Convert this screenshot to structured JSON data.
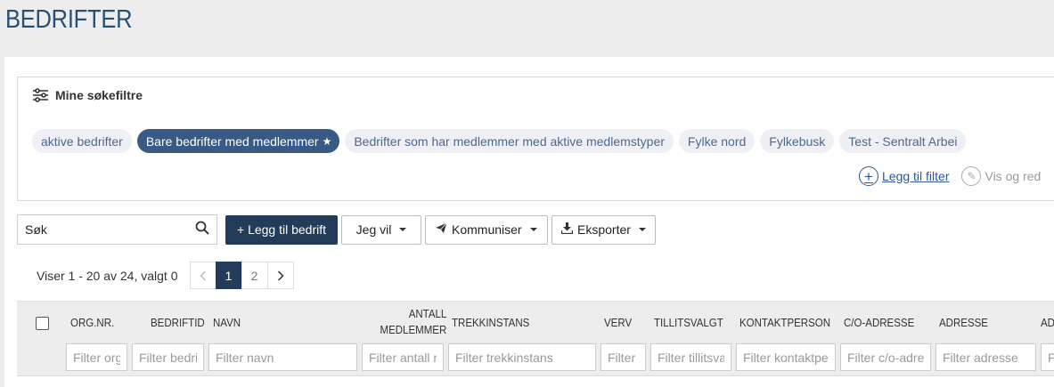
{
  "page": {
    "title": "BEDRIFTER"
  },
  "saved_filters": {
    "title": "Mine søkefiltre",
    "chips": [
      {
        "label": "aktive bedrifter",
        "active": false
      },
      {
        "label": "Bare bedrifter med medlemmer",
        "active": true,
        "icon": "star-icon"
      },
      {
        "label": "Bedrifter som har medlemmer med aktive medlemstyper",
        "active": false
      },
      {
        "label": "Fylke nord",
        "active": false
      },
      {
        "label": "Fylkebusk",
        "active": false
      },
      {
        "label": "Test - Sentralt Arbei",
        "active": false
      }
    ],
    "add_label": "Legg til filter",
    "edit_label": "Vis og red"
  },
  "toolbar": {
    "search_placeholder": "Søk",
    "add_company_label": "+ Legg til bedrift",
    "i_want_label": "Jeg vil",
    "communicate_label": "Kommuniser",
    "export_label": "Eksporter"
  },
  "pagination": {
    "info": "Viser 1 - 20 av 24, valgt 0",
    "pages": [
      "1",
      "2"
    ],
    "current": "1"
  },
  "table": {
    "columns": [
      {
        "label": "ORG.NR.",
        "filter": "Filter org"
      },
      {
        "label": "BEDRIFTID",
        "filter": "Filter bedri"
      },
      {
        "label": "NAVN",
        "filter": "Filter navn"
      },
      {
        "label": "ANTALL",
        "label2": "MEDLEMMER",
        "filter": "Filter antall m"
      },
      {
        "label": "TREKKINSTANS",
        "filter": "Filter trekkinstans"
      },
      {
        "label": "VERV",
        "filter": "Filter"
      },
      {
        "label": "TILLITSVALGT",
        "filter": "Filter tillitsvalgt"
      },
      {
        "label": "KONTAKTPERSON",
        "filter": "Filter kontaktpe"
      },
      {
        "label": "C/O-ADRESSE",
        "filter": "Filter c/o-adre"
      },
      {
        "label": "ADRESSE",
        "filter": "Filter adresse"
      },
      {
        "label": "AD",
        "filter": "Fil"
      }
    ]
  },
  "colors": {
    "primary": "#233c5a",
    "chip_active": "#395a85",
    "link": "#2a5a8e",
    "title": "#2a4f72"
  }
}
